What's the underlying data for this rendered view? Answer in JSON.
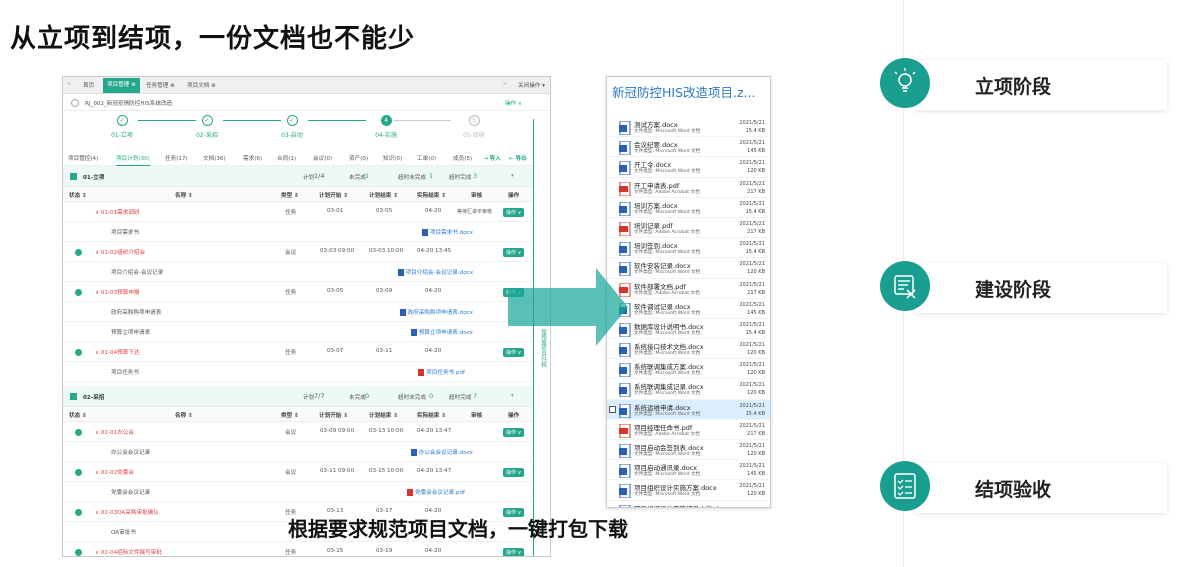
{
  "headline": "从立项到结项，一份文档也不能少",
  "caption": "根据要求规范项目文档，一键打包下载",
  "app": {
    "tabs": [
      "首页",
      "项目管理 ⊗",
      "任务管理 ⊗",
      "项目文档 ⊗"
    ],
    "tab_close_all": "关闭操作 ▾",
    "project_name": "RJ_002_新冠疫情防控HIS系统改造",
    "op_menu": "操作 ∨",
    "steps": [
      {
        "num": "✓",
        "label": "01-立项"
      },
      {
        "num": "✓",
        "label": "02-采招"
      },
      {
        "num": "✓",
        "label": "03-启动"
      },
      {
        "num": "4",
        "label": "04-实施"
      },
      {
        "num": "5",
        "label": "05-验收"
      }
    ],
    "subtabs": [
      "项目管控(4)",
      "项目计划(30)",
      "任务(17)",
      "文档(36)",
      "需求(6)",
      "合同(1)",
      "会议(0)",
      "资产(0)",
      "知识(0)",
      "工单(0)",
      "成员(5)"
    ],
    "import": "导入",
    "export": "导出",
    "header_cols": [
      "状态 ⇕",
      "名称 ⇕",
      "类型 ⇕",
      "计划开始 ⇕",
      "计划结束 ⇕",
      "实际结束 ⇕",
      "审核",
      "操作"
    ],
    "groups": [
      {
        "name": "01-立项",
        "plan_label": "计划",
        "plan": "1/4",
        "unfinished_label": "未完成",
        "unfinished": "1",
        "overdue_label": "超时未完成",
        "overdue": "1",
        "late_label": "超时完成",
        "late": "3",
        "rows": [
          {
            "status": "",
            "name": "01-01需求调研",
            "type": "任务",
            "start": "03-01",
            "end": "03-05",
            "actual": "04-20",
            "audit": "等待汇卓平审核",
            "op": "操作 ∨",
            "kind": "task",
            "red": true
          },
          {
            "status": "",
            "name": "项目需求书",
            "file": "项目需求书.docx",
            "kind": "file",
            "ftype": "w"
          },
          {
            "status": "ok",
            "name": "01-02组织介绍会",
            "type": "会议",
            "start": "03-03 09:00",
            "end": "03-03 10:00",
            "actual": "04-20 13:45",
            "op": "操作 ∨",
            "kind": "task",
            "red": true
          },
          {
            "status": "",
            "name": "项目介绍会-会议记录",
            "file": "项目介绍会-会议记录.docx",
            "kind": "file",
            "ftype": "w"
          },
          {
            "status": "ok",
            "name": "01-03预算申报",
            "type": "任务",
            "start": "03-05",
            "end": "03-09",
            "actual": "04-20",
            "op": "操作 ∨",
            "kind": "task",
            "red": true
          },
          {
            "status": "",
            "name": "政府采购购项申请表",
            "file": "政府采购购项申请表.docx",
            "kind": "file",
            "ftype": "w"
          },
          {
            "status": "",
            "name": "预算立项申请表",
            "file": "预算立项申请表.docx",
            "kind": "file",
            "ftype": "w"
          },
          {
            "status": "ok",
            "name": "01-04预算下达",
            "type": "任务",
            "start": "03-07",
            "end": "03-11",
            "actual": "04-20",
            "op": "操作 ∨",
            "kind": "task",
            "red": true
          },
          {
            "status": "",
            "name": "项目任务书",
            "file": "项目任务书.pdf",
            "kind": "file",
            "ftype": "p"
          }
        ]
      },
      {
        "name": "02-采招",
        "plan_label": "计划",
        "plan": "7/7",
        "unfinished_label": "未完成",
        "unfinished": "0",
        "overdue_label": "超时未完成",
        "overdue": "0",
        "late_label": "超时完成",
        "late": "7",
        "rows": [
          {
            "status": "ok",
            "name": "02-01办公会",
            "type": "会议",
            "start": "03-09 09:00",
            "end": "03-13 10:00",
            "actual": "04-20 13:47",
            "op": "操作 ∨",
            "kind": "task",
            "red": true
          },
          {
            "status": "",
            "name": "办公会会议记录",
            "file": "办公会会议记录.docx",
            "kind": "file",
            "ftype": "w"
          },
          {
            "status": "ok",
            "name": "02-02党委会",
            "type": "会议",
            "start": "03-11 09:00",
            "end": "03-15 10:00",
            "actual": "04-20 13:47",
            "op": "操作 ∨",
            "kind": "task",
            "red": true
          },
          {
            "status": "",
            "name": "党委会会议记录",
            "file": "党委会会议记录.pdf",
            "kind": "file",
            "ftype": "p"
          },
          {
            "status": "ok",
            "name": "02-03OA采购审批确认",
            "type": "任务",
            "start": "03-13",
            "end": "03-17",
            "actual": "04-20",
            "op": "操作 ∨",
            "kind": "task",
            "red": true
          },
          {
            "status": "",
            "name": "OA审批书",
            "kind": "file"
          },
          {
            "status": "ok",
            "name": "02-04招标文件撰写审批",
            "type": "任务",
            "start": "03-15",
            "end": "03-19",
            "actual": "04-20",
            "op": "操作 ∨",
            "kind": "task",
            "red": true
          }
        ]
      }
    ],
    "side_label": "按预算项目归档"
  },
  "zip": {
    "title": "新冠防控HIS改造项目.z...",
    "files": [
      {
        "name": "测试方案.docx",
        "type": "文件类型: Microsoft Word 文档",
        "date": "2021/5/21",
        "size": "15.4 KB",
        "kind": "w"
      },
      {
        "name": "会议纪要.docx",
        "type": "文件类型: Microsoft Word 文档",
        "date": "2021/5/21",
        "size": "145 KB",
        "kind": "w"
      },
      {
        "name": "开工令.docx",
        "type": "文件类型: Microsoft Word 文档",
        "date": "2021/5/21",
        "size": "120 KB",
        "kind": "w"
      },
      {
        "name": "开工申请表.pdf",
        "type": "文件类型: Adobe Acrobat 文档",
        "date": "2021/5/21",
        "size": "217 KB",
        "kind": "p"
      },
      {
        "name": "培训方案.docx",
        "type": "文件类型: Microsoft Word 文档",
        "date": "2021/5/21",
        "size": "15.4 KB",
        "kind": "w"
      },
      {
        "name": "培训记录.pdf",
        "type": "文件类型: Adobe Acrobat 文档",
        "date": "2021/5/21",
        "size": "217 KB",
        "kind": "p"
      },
      {
        "name": "培训签到.docx",
        "type": "文件类型: Microsoft Word 文档",
        "date": "2021/5/21",
        "size": "15.4 KB",
        "kind": "w"
      },
      {
        "name": "软件安装记录.docx",
        "type": "文件类型: Microsoft Word 文档",
        "date": "2021/5/21",
        "size": "120 KB",
        "kind": "w"
      },
      {
        "name": "软件部署文档.pdf",
        "type": "文件类型: Adobe Acrobat 文档",
        "date": "2021/5/21",
        "size": "217 KB",
        "kind": "p"
      },
      {
        "name": "软件调试记录.docx",
        "type": "文件类型: Microsoft Word 文档",
        "date": "2021/5/21",
        "size": "145 KB",
        "kind": "w"
      },
      {
        "name": "数据库设计说明书.docx",
        "type": "文件类型: Microsoft Word 文档",
        "date": "2021/5/21",
        "size": "15.4 KB",
        "kind": "w"
      },
      {
        "name": "系统接口技术文档.docx",
        "type": "文件类型: Microsoft Word 文档",
        "date": "2021/5/21",
        "size": "120 KB",
        "kind": "w"
      },
      {
        "name": "系统联调集成方案.docx",
        "type": "文件类型: Microsoft Word 文档",
        "date": "2021/5/21",
        "size": "120 KB",
        "kind": "w"
      },
      {
        "name": "系统联调集成记录.docx",
        "type": "文件类型: Microsoft Word 文档",
        "date": "2021/5/21",
        "size": "120 KB",
        "kind": "w"
      },
      {
        "name": "系统运维申请.docx",
        "type": "文件类型: Microsoft Word 文档",
        "date": "2021/5/21",
        "size": "15.4 KB",
        "kind": "w",
        "sel": true
      },
      {
        "name": "项目经理任命书.pdf",
        "type": "文件类型: Adobe Acrobat 文档",
        "date": "2021/5/21",
        "size": "217 KB",
        "kind": "p"
      },
      {
        "name": "项目启动会签到表.docx",
        "type": "文件类型: Microsoft Word 文档",
        "date": "2021/5/21",
        "size": "120 KB",
        "kind": "w"
      },
      {
        "name": "项目启动通讯录.docx",
        "type": "文件类型: Microsoft Word 文档",
        "date": "2021/5/21",
        "size": "145 KB",
        "kind": "w"
      },
      {
        "name": "项目组织设计实施方案.docx",
        "type": "文件类型: Microsoft Word 文档",
        "date": "2021/5/21",
        "size": "120 KB",
        "kind": "w"
      },
      {
        "name": "项目组织设计实施结果文档.docx",
        "type": "",
        "date": "",
        "size": "",
        "kind": "w"
      }
    ]
  },
  "phases": [
    {
      "label": "立项阶段",
      "icon": "lightbulb-icon"
    },
    {
      "label": "建设阶段",
      "icon": "build-icon"
    },
    {
      "label": "结项验收",
      "icon": "checklist-icon"
    }
  ],
  "colors": {
    "accent": "#25a78b",
    "phase": "#1a9e8f",
    "link": "#2b79c6",
    "red": "#e04040"
  }
}
